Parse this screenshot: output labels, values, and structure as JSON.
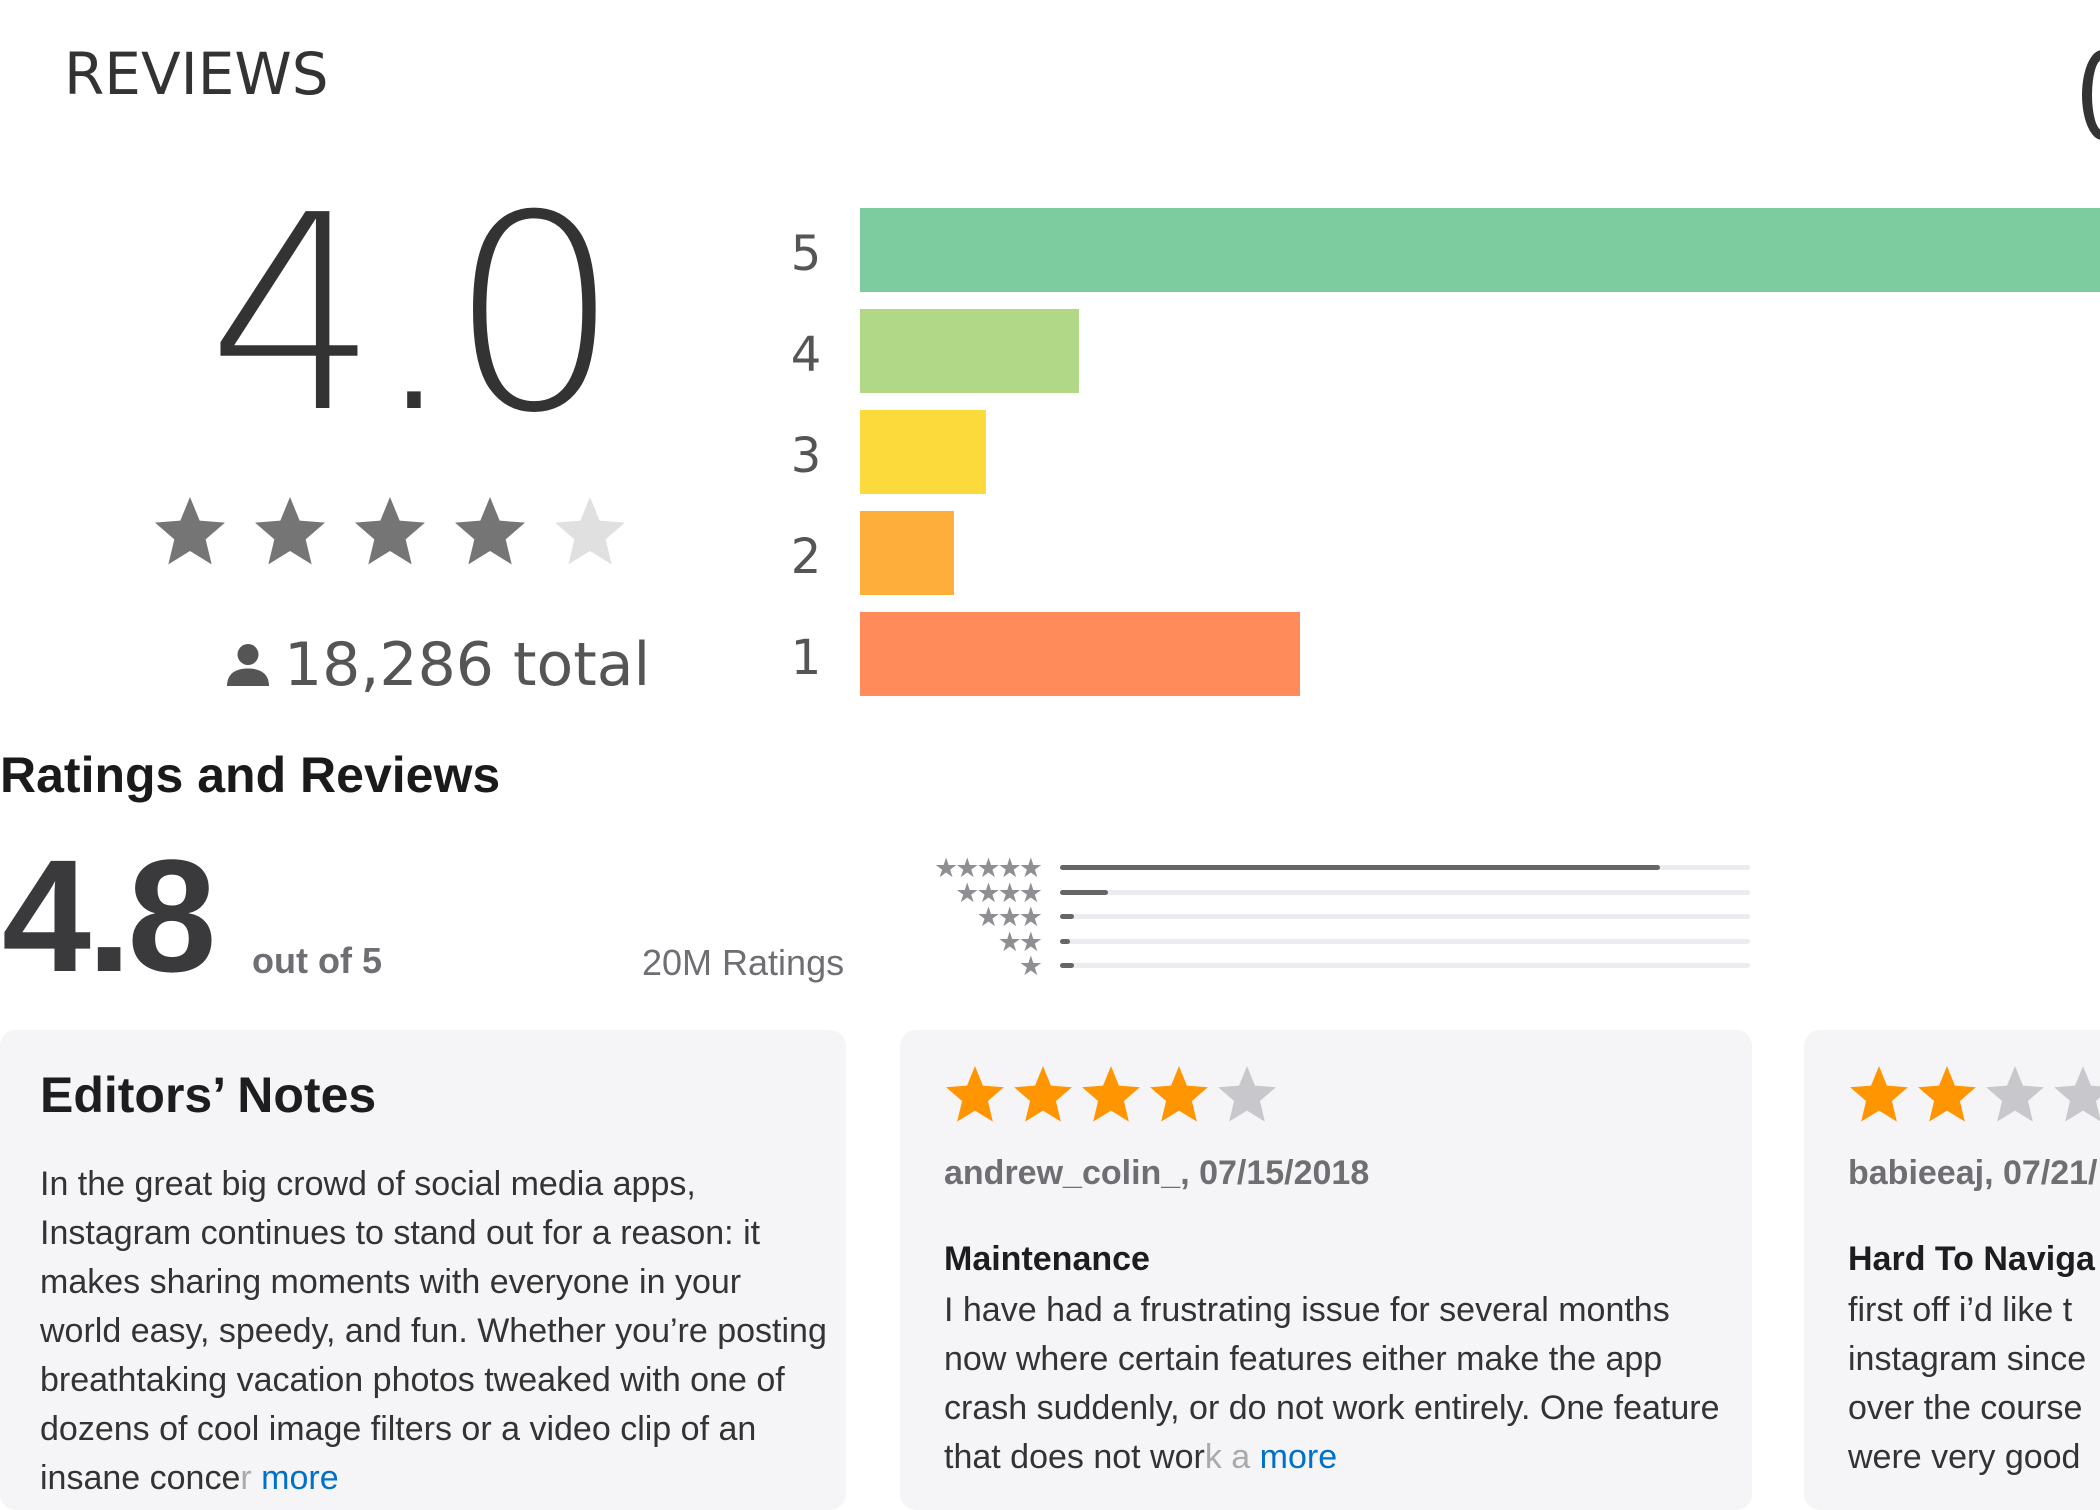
{
  "top": {
    "title": "REVIEWS",
    "score": "4.0",
    "stars_filled": 4,
    "stars_total": 5,
    "total": "18,286 total",
    "star_color_filled": "#757575",
    "star_color_empty": "#e0e0e0",
    "bars": [
      {
        "label": "5",
        "fraction": 1.0,
        "color": "#7ccc9f"
      },
      {
        "label": "4",
        "fraction": 0.177,
        "color": "#b0d887"
      },
      {
        "label": "3",
        "fraction": 0.102,
        "color": "#fcda3b"
      },
      {
        "label": "2",
        "fraction": 0.076,
        "color": "#fdae3b"
      },
      {
        "label": "1",
        "fraction": 0.355,
        "color": "#ff8b5a"
      }
    ]
  },
  "ratings": {
    "title": "Ratings and Reviews",
    "score": "4.8",
    "out_of": "out of 5",
    "count": "20M Ratings",
    "histogram": [
      {
        "stars": "★★★★★",
        "fraction": 0.87
      },
      {
        "stars": "★★★★",
        "fraction": 0.07
      },
      {
        "stars": "★★★",
        "fraction": 0.02
      },
      {
        "stars": "★★",
        "fraction": 0.01
      },
      {
        "stars": "★",
        "fraction": 0.02
      }
    ]
  },
  "cards": {
    "editors": {
      "heading": "Editors’ Notes",
      "body": "In the great big crowd of social media apps, Instagram continues to stand out for a reason: it makes sharing moments with everyone in your world easy, speedy, and fun. Whether you’re posting breathtaking vacation photos tweaked with one of dozens of cool image filters or a video clip of an insane conce",
      "fade": "r",
      "more": "more"
    },
    "review1": {
      "stars_filled": 4,
      "stars_total": 5,
      "meta": "andrew_colin_, 07/15/2018",
      "title": "Maintenance",
      "body": "I have had a frustrating issue for several months now where certain features either make the app crash suddenly, or do not work entirely. One feature that does not wor",
      "fade": "k a",
      "more": "more"
    },
    "review2": {
      "stars_filled": 2,
      "stars_total": 5,
      "meta": "babieeaj, 07/21/",
      "title": "Hard To Naviga",
      "body": "first off i’d like t instagram since over the course were very good"
    },
    "star_color_filled": "#ff9500",
    "star_color_empty": "#c7c7cc"
  }
}
